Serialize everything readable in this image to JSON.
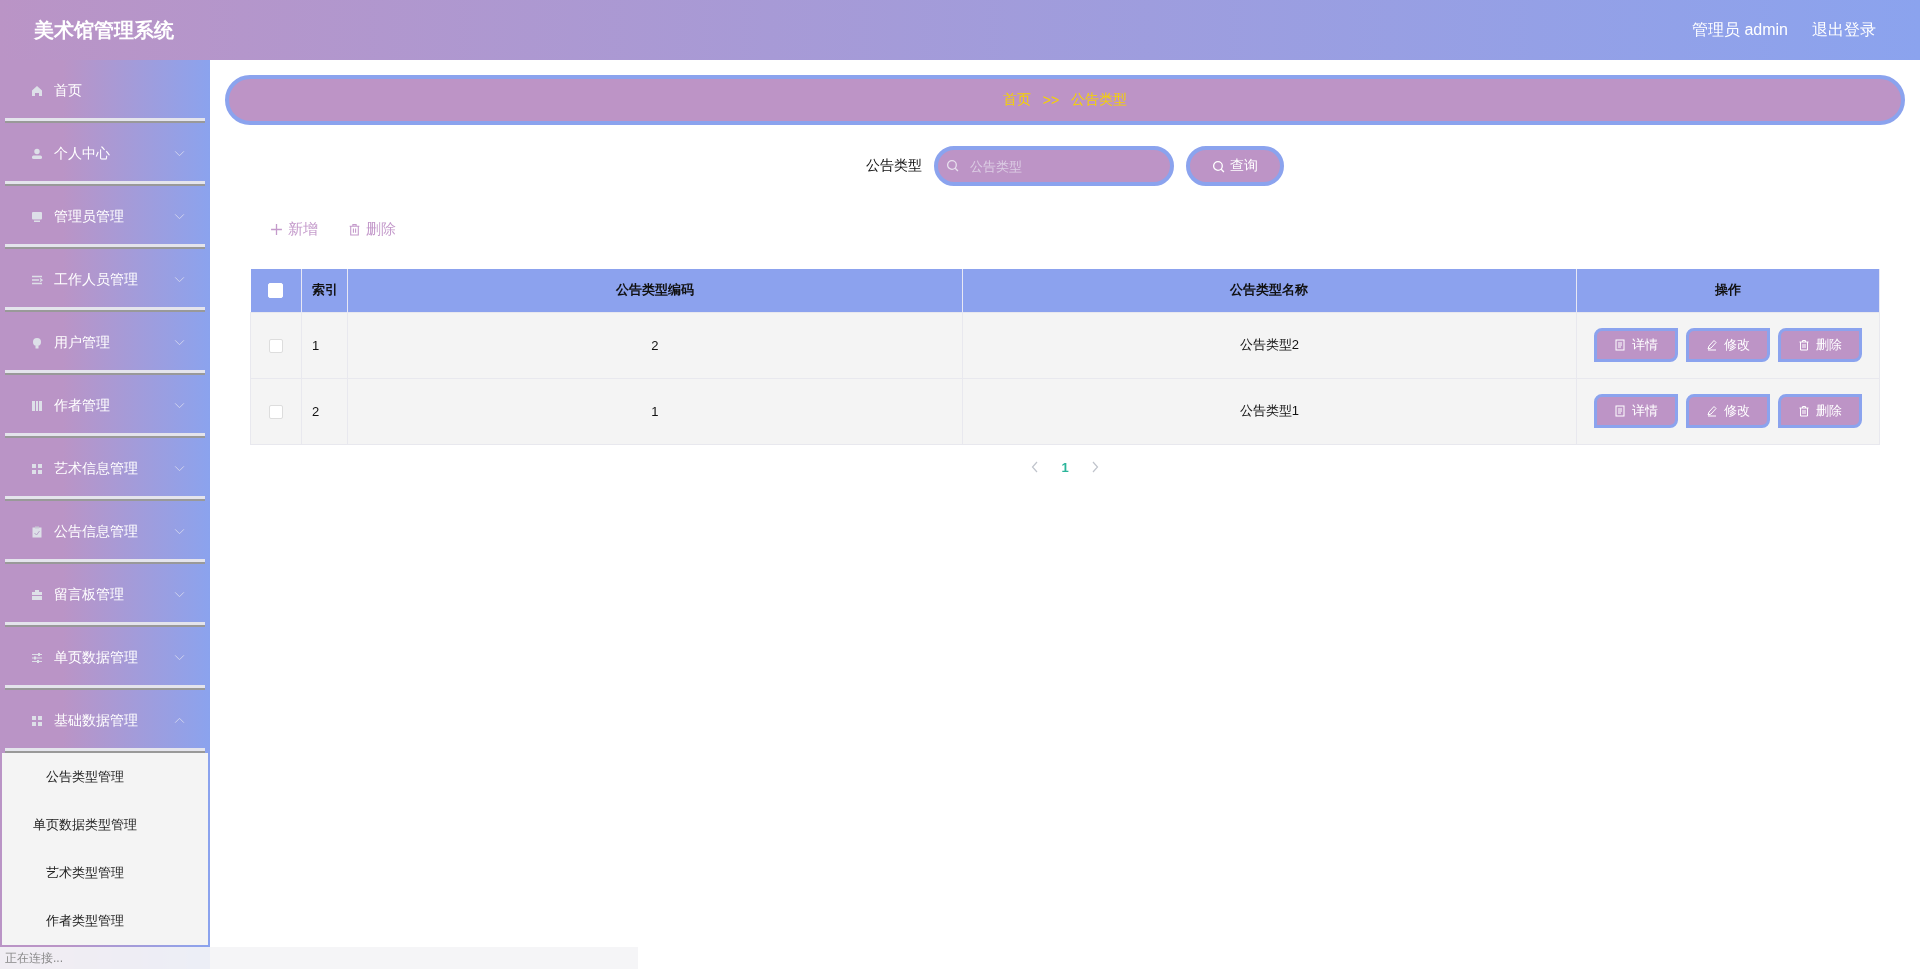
{
  "header": {
    "title": "美术馆管理系统",
    "user": "管理员 admin",
    "logout": "退出登录"
  },
  "sidebar": {
    "items": [
      {
        "label": "首页"
      },
      {
        "label": "个人中心",
        "expanded": false
      },
      {
        "label": "管理员管理",
        "expanded": false
      },
      {
        "label": "工作人员管理",
        "expanded": false
      },
      {
        "label": "用户管理",
        "expanded": false
      },
      {
        "label": "作者管理",
        "expanded": false
      },
      {
        "label": "艺术信息管理",
        "expanded": false
      },
      {
        "label": "公告信息管理",
        "expanded": false
      },
      {
        "label": "留言板管理",
        "expanded": false
      },
      {
        "label": "单页数据管理",
        "expanded": false
      },
      {
        "label": "基础数据管理",
        "expanded": true,
        "children": [
          {
            "label": "公告类型管理"
          },
          {
            "label": "单页数据类型管理"
          },
          {
            "label": "艺术类型管理"
          },
          {
            "label": "作者类型管理"
          }
        ]
      }
    ]
  },
  "breadcrumb": [
    "首页",
    ">>",
    "公告类型"
  ],
  "search": {
    "label": "公告类型",
    "placeholder": "公告类型",
    "button": "查询"
  },
  "actions": [
    "新增",
    "删除"
  ],
  "table": {
    "header_checked": false,
    "columns": [
      "索引",
      "公告类型编码",
      "公告类型名称",
      "操作"
    ],
    "rows": [
      {
        "checked": false,
        "cells": [
          "1",
          "2",
          "公告类型2"
        ],
        "buttons": [
          "详情",
          "修改",
          "删除"
        ]
      },
      {
        "checked": false,
        "cells": [
          "2",
          "1",
          "公告类型1"
        ],
        "buttons": [
          "详情",
          "修改",
          "删除"
        ]
      }
    ]
  },
  "pagination": {
    "pages": [
      {
        "label": "1",
        "selected": true
      }
    ]
  },
  "status_bar": "正在连接..."
}
